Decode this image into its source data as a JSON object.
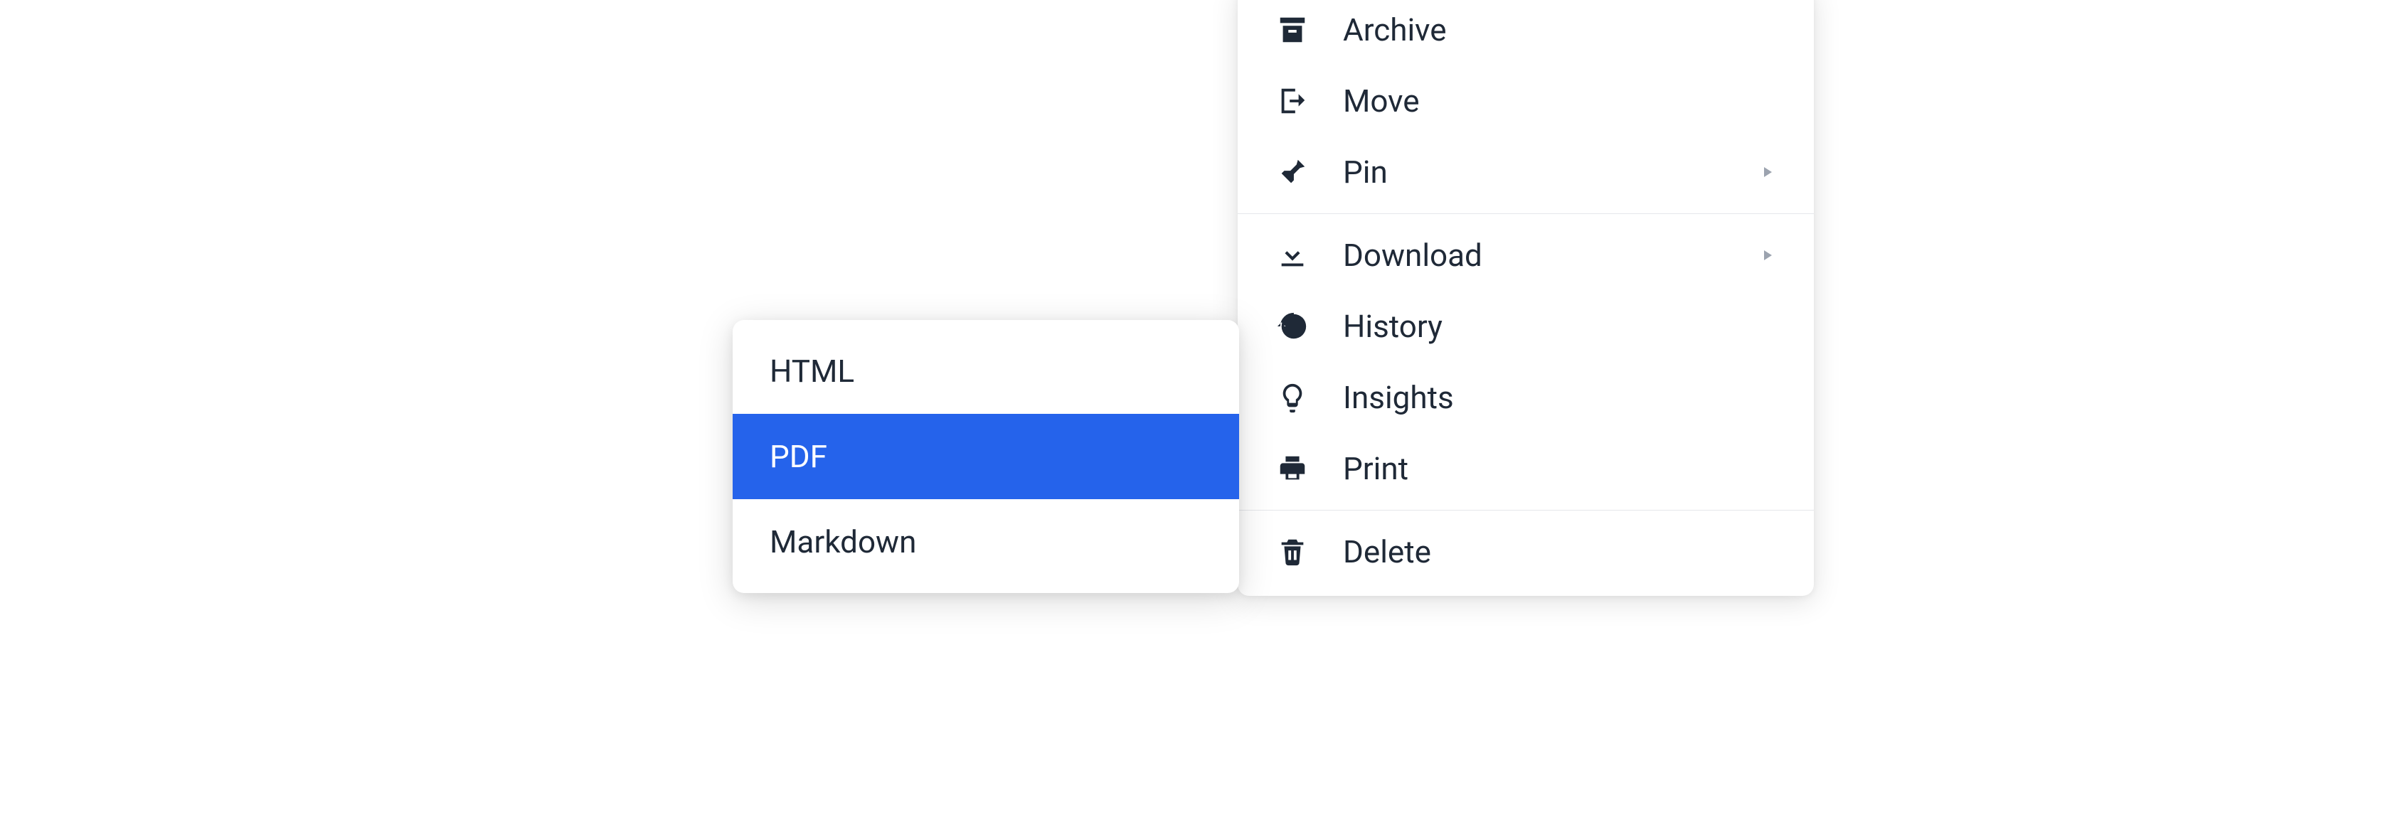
{
  "menu": {
    "groups": [
      {
        "items": [
          {
            "key": "archive",
            "label": "Archive",
            "icon": "archive-icon",
            "hasSubmenu": false
          },
          {
            "key": "move",
            "label": "Move",
            "icon": "move-icon",
            "hasSubmenu": false
          },
          {
            "key": "pin",
            "label": "Pin",
            "icon": "pin-icon",
            "hasSubmenu": true
          }
        ]
      },
      {
        "items": [
          {
            "key": "download",
            "label": "Download",
            "icon": "download-icon",
            "hasSubmenu": true
          },
          {
            "key": "history",
            "label": "History",
            "icon": "history-icon",
            "hasSubmenu": false
          },
          {
            "key": "insights",
            "label": "Insights",
            "icon": "insights-icon",
            "hasSubmenu": false
          },
          {
            "key": "print",
            "label": "Print",
            "icon": "print-icon",
            "hasSubmenu": false
          }
        ]
      },
      {
        "items": [
          {
            "key": "delete",
            "label": "Delete",
            "icon": "delete-icon",
            "hasSubmenu": false
          }
        ]
      }
    ]
  },
  "submenu": {
    "items": [
      {
        "key": "html",
        "label": "HTML",
        "selected": false
      },
      {
        "key": "pdf",
        "label": "PDF",
        "selected": true
      },
      {
        "key": "markdown",
        "label": "Markdown",
        "selected": false
      }
    ]
  }
}
